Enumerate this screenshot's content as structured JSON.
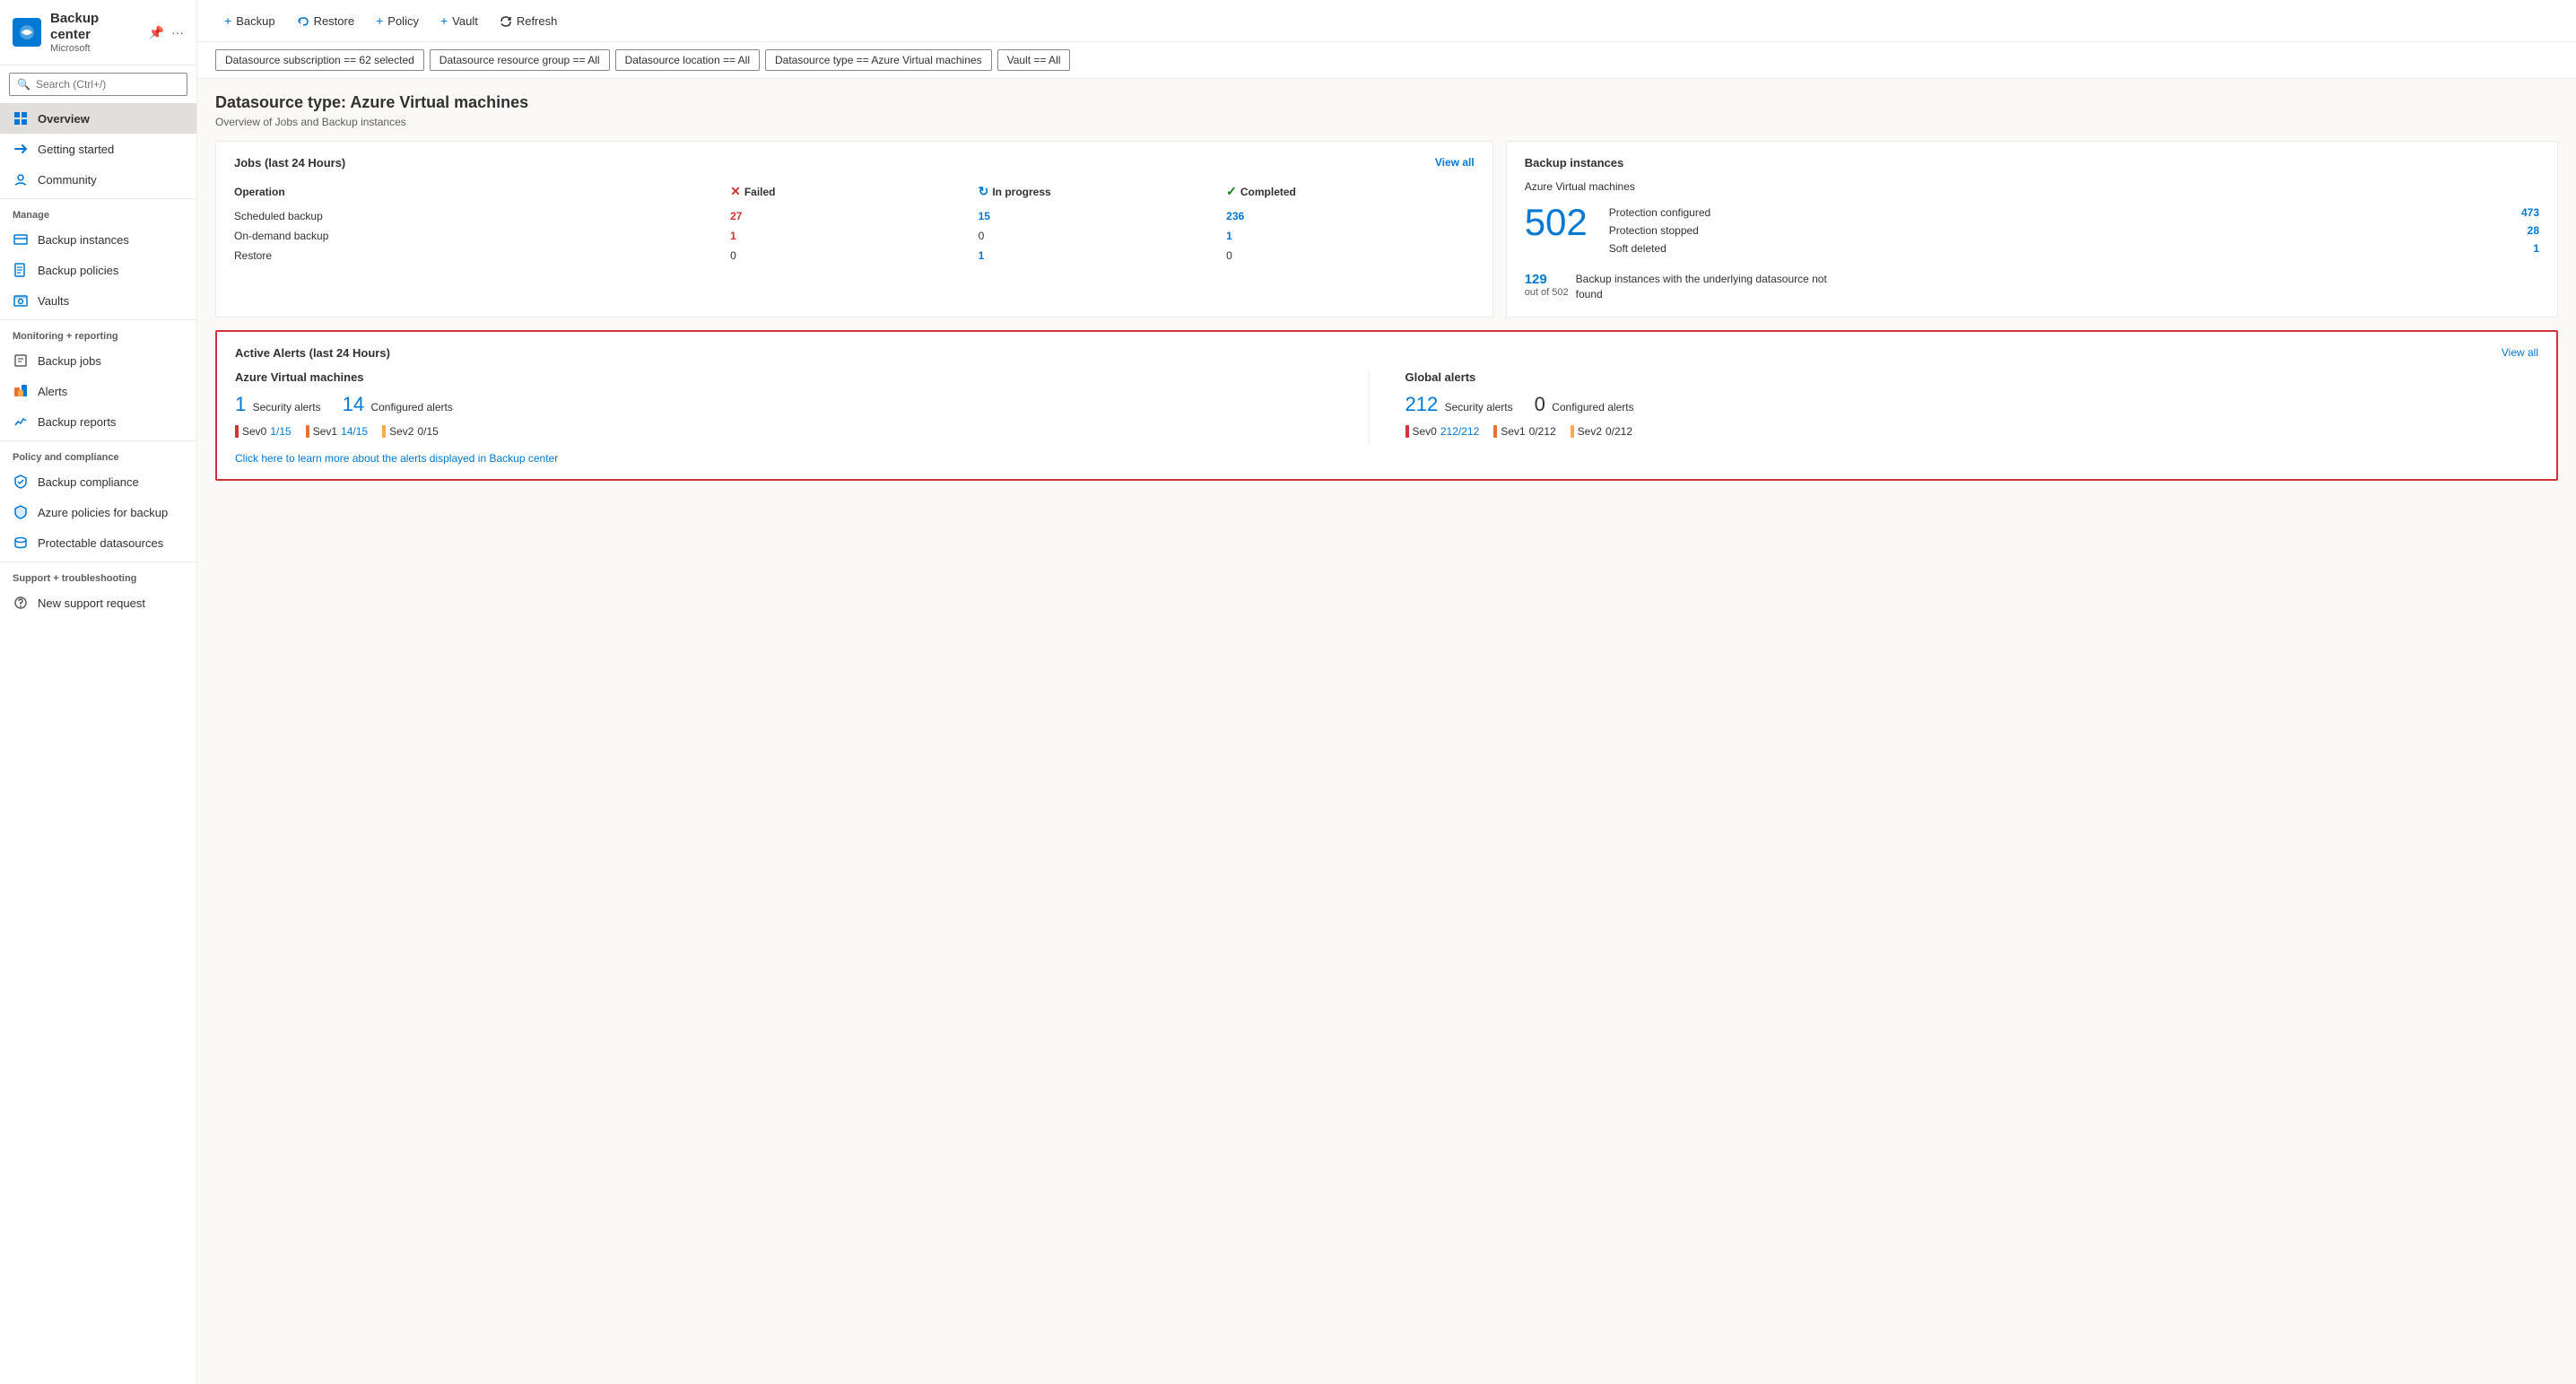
{
  "app": {
    "title": "Backup center",
    "subtitle": "Microsoft"
  },
  "search": {
    "placeholder": "Search (Ctrl+/)"
  },
  "toolbar": {
    "buttons": [
      {
        "id": "backup",
        "label": "Backup",
        "icon": "plus"
      },
      {
        "id": "restore",
        "label": "Restore",
        "icon": "restore"
      },
      {
        "id": "policy",
        "label": "Policy",
        "icon": "plus"
      },
      {
        "id": "vault",
        "label": "Vault",
        "icon": "plus"
      },
      {
        "id": "refresh",
        "label": "Refresh",
        "icon": "refresh"
      }
    ]
  },
  "filters": [
    {
      "id": "subscription",
      "label": "Datasource subscription == 62 selected"
    },
    {
      "id": "resource-group",
      "label": "Datasource resource group == All"
    },
    {
      "id": "location",
      "label": "Datasource location == All"
    },
    {
      "id": "type",
      "label": "Datasource type == Azure Virtual machines"
    },
    {
      "id": "vault",
      "label": "Vault == All"
    }
  ],
  "datasource": {
    "title": "Datasource type: Azure Virtual machines",
    "subtitle": "Overview of Jobs and Backup instances"
  },
  "jobs_card": {
    "title": "Jobs (last 24 Hours)",
    "view_all": "View all",
    "headers": {
      "operation": "Operation",
      "failed": "Failed",
      "in_progress": "In progress",
      "completed": "Completed"
    },
    "rows": [
      {
        "operation": "Scheduled backup",
        "failed": "27",
        "in_progress": "15",
        "completed": "236"
      },
      {
        "operation": "On-demand backup",
        "failed": "1",
        "in_progress": "0",
        "completed": "1"
      },
      {
        "operation": "Restore",
        "failed": "0",
        "in_progress": "1",
        "completed": "0"
      }
    ]
  },
  "backup_instances_card": {
    "title": "Backup instances",
    "type_label": "Azure Virtual machines",
    "total_count": "502",
    "details": [
      {
        "label": "Protection configured",
        "value": "473"
      },
      {
        "label": "Protection stopped",
        "value": "28"
      },
      {
        "label": "Soft deleted",
        "value": "1"
      }
    ],
    "footer_count": "129",
    "footer_sub": "out of 502",
    "footer_text": "Backup instances with the underlying datasource not found"
  },
  "alerts_card": {
    "title": "Active Alerts (last 24 Hours)",
    "view_all": "View all",
    "azure_vm": {
      "title": "Azure Virtual machines",
      "security_label": "Security alerts",
      "security_count": "1",
      "configured_label": "Configured alerts",
      "configured_count": "14",
      "severities": [
        {
          "level": "Sev0",
          "bar_color": "red",
          "value": "1/15",
          "is_blue": true
        },
        {
          "level": "Sev1",
          "bar_color": "orange",
          "value": "14/15",
          "is_blue": true
        },
        {
          "level": "Sev2",
          "bar_color": "yellow",
          "value": "0/15",
          "is_blue": false
        }
      ]
    },
    "global": {
      "title": "Global alerts",
      "security_label": "Security alerts",
      "security_count": "212",
      "configured_label": "Configured alerts",
      "configured_count": "0",
      "severities": [
        {
          "level": "Sev0",
          "bar_color": "red",
          "value": "212/212",
          "is_blue": true
        },
        {
          "level": "Sev1",
          "bar_color": "orange",
          "value": "0/212",
          "is_blue": false
        },
        {
          "level": "Sev2",
          "bar_color": "yellow",
          "value": "0/212",
          "is_blue": false
        }
      ]
    },
    "link_text": "Click here to learn more about the alerts displayed in Backup center"
  },
  "sidebar": {
    "nav_items": [
      {
        "id": "overview",
        "label": "Overview",
        "active": true,
        "icon": "overview"
      },
      {
        "id": "getting-started",
        "label": "Getting started",
        "active": false,
        "icon": "started"
      },
      {
        "id": "community",
        "label": "Community",
        "active": false,
        "icon": "community"
      }
    ],
    "manage_section": "Manage",
    "manage_items": [
      {
        "id": "backup-instances",
        "label": "Backup instances",
        "icon": "instances"
      },
      {
        "id": "backup-policies",
        "label": "Backup policies",
        "icon": "policies"
      },
      {
        "id": "vaults",
        "label": "Vaults",
        "icon": "vaults"
      }
    ],
    "monitoring_section": "Monitoring + reporting",
    "monitoring_items": [
      {
        "id": "backup-jobs",
        "label": "Backup jobs",
        "icon": "jobs"
      },
      {
        "id": "alerts",
        "label": "Alerts",
        "icon": "alerts"
      },
      {
        "id": "backup-reports",
        "label": "Backup reports",
        "icon": "reports"
      }
    ],
    "policy_section": "Policy and compliance",
    "policy_items": [
      {
        "id": "backup-compliance",
        "label": "Backup compliance",
        "icon": "compliance"
      },
      {
        "id": "azure-policies",
        "label": "Azure policies for backup",
        "icon": "azure-policy"
      },
      {
        "id": "protectable-datasources",
        "label": "Protectable datasources",
        "icon": "datasources"
      }
    ],
    "support_section": "Support + troubleshooting",
    "support_items": [
      {
        "id": "new-support-request",
        "label": "New support request",
        "icon": "support"
      }
    ]
  }
}
